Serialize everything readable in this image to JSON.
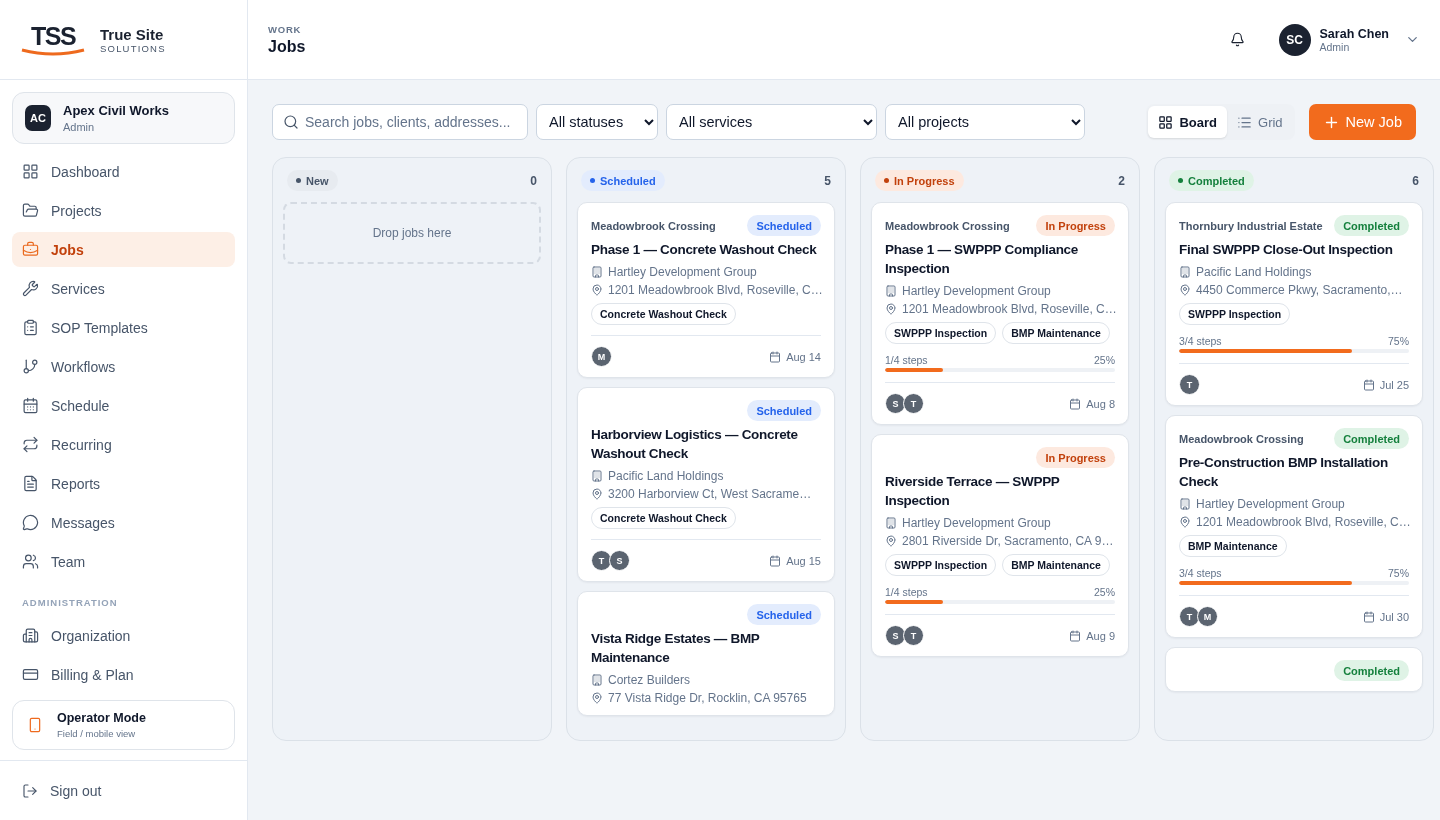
{
  "brand": {
    "mark": "TSS",
    "name": "True Site",
    "tagline": "SOLUTIONS"
  },
  "organization": {
    "initials": "AC",
    "name": "Apex Civil Works",
    "role": "Admin"
  },
  "sidebar": {
    "items": [
      {
        "label": "Dashboard",
        "selected": false
      },
      {
        "label": "Projects",
        "selected": false
      },
      {
        "label": "Jobs",
        "selected": true
      },
      {
        "label": "Services",
        "selected": false
      },
      {
        "label": "SOP Templates",
        "selected": false
      },
      {
        "label": "Workflows",
        "selected": false
      },
      {
        "label": "Schedule",
        "selected": false
      },
      {
        "label": "Recurring",
        "selected": false
      },
      {
        "label": "Reports",
        "selected": false
      },
      {
        "label": "Messages",
        "selected": false
      },
      {
        "label": "Team",
        "selected": false
      }
    ],
    "section_label": "ADMINISTRATION",
    "admin_items": [
      {
        "label": "Organization",
        "selected": false
      },
      {
        "label": "Billing & Plan",
        "selected": false
      }
    ],
    "operator_mode": {
      "title": "Operator Mode",
      "subtitle": "Field / mobile view"
    },
    "sign_out": "Sign out"
  },
  "header": {
    "eyebrow": "WORK",
    "title": "Jobs",
    "user": {
      "initials": "SC",
      "name": "Sarah Chen",
      "role": "Admin"
    }
  },
  "toolbar": {
    "search": {
      "placeholder": "Search jobs, clients, addresses..."
    },
    "filters": [
      "All statuses",
      "All services",
      "All projects"
    ],
    "views": [
      {
        "label": "Board",
        "selected": true
      },
      {
        "label": "Grid",
        "selected": false
      }
    ],
    "new_button": "New Job"
  },
  "board": {
    "columns": [
      {
        "label": "New",
        "kind": "new",
        "count": "0",
        "empty_text": "Drop jobs here"
      },
      {
        "label": "Scheduled",
        "kind": "scheduled",
        "count": "5",
        "cards": [
          {
            "project": "Meadowbrook Crossing",
            "badge": "Scheduled",
            "title": "Phase 1 — Concrete Washout Check",
            "client": "Hartley Development Group",
            "address": "1201 Meadowbrook Blvd, Roseville, C…",
            "tags": [
              "Concrete Washout Check"
            ],
            "assignees": [
              "M"
            ],
            "date": "Aug 14"
          },
          {
            "badge": "Scheduled",
            "title": "Harborview Logistics — Concrete Washout Check",
            "client": "Pacific Land Holdings",
            "address": "3200 Harborview Ct, West Sacrame…",
            "tags": [
              "Concrete Washout Check"
            ],
            "assignees": [
              "T",
              "S"
            ],
            "date": "Aug 15"
          },
          {
            "badge": "Scheduled",
            "title": "Vista Ridge Estates — BMP Maintenance",
            "client": "Cortez Builders",
            "address": "77 Vista Ridge Dr, Rocklin, CA 95765"
          }
        ]
      },
      {
        "label": "In Progress",
        "kind": "in_progress",
        "count": "2",
        "cards": [
          {
            "project": "Meadowbrook Crossing",
            "badge": "In Progress",
            "title": "Phase 1 — SWPPP Compliance Inspection",
            "client": "Hartley Development Group",
            "address": "1201 Meadowbrook Blvd, Roseville, C…",
            "tags": [
              "SWPPP Inspection",
              "BMP Maintenance"
            ],
            "progress": {
              "steps": "1/4 steps",
              "percent": "25%",
              "level": 0.25
            },
            "assignees": [
              "S",
              "T"
            ],
            "date": "Aug 8"
          },
          {
            "badge": "In Progress",
            "title": "Riverside Terrace — SWPPP Inspection",
            "client": "Hartley Development Group",
            "address": "2801 Riverside Dr, Sacramento, CA 9…",
            "tags": [
              "SWPPP Inspection",
              "BMP Maintenance"
            ],
            "progress": {
              "steps": "1/4 steps",
              "percent": "25%",
              "level": 0.25
            },
            "assignees": [
              "S",
              "T"
            ],
            "date": "Aug 9"
          }
        ]
      },
      {
        "label": "Completed",
        "kind": "completed",
        "count": "6",
        "cards": [
          {
            "project": "Thornbury Industrial Estate",
            "badge": "Completed",
            "title": "Final SWPPP Close-Out Inspection",
            "client": "Pacific Land Holdings",
            "address": "4450 Commerce Pkwy, Sacramento,…",
            "tags": [
              "SWPPP Inspection"
            ],
            "progress": {
              "steps": "3/4 steps",
              "percent": "75%",
              "level": 0.75
            },
            "assignees": [
              "T"
            ],
            "date": "Jul 25"
          },
          {
            "project": "Meadowbrook Crossing",
            "badge": "Completed",
            "title": "Pre-Construction BMP Installation Check",
            "client": "Hartley Development Group",
            "address": "1201 Meadowbrook Blvd, Roseville, C…",
            "tags": [
              "BMP Maintenance"
            ],
            "progress": {
              "steps": "3/4 steps",
              "percent": "75%",
              "level": 0.75
            },
            "assignees": [
              "T",
              "M"
            ],
            "date": "Jul 30"
          },
          {
            "badge": "Completed"
          }
        ]
      }
    ]
  }
}
